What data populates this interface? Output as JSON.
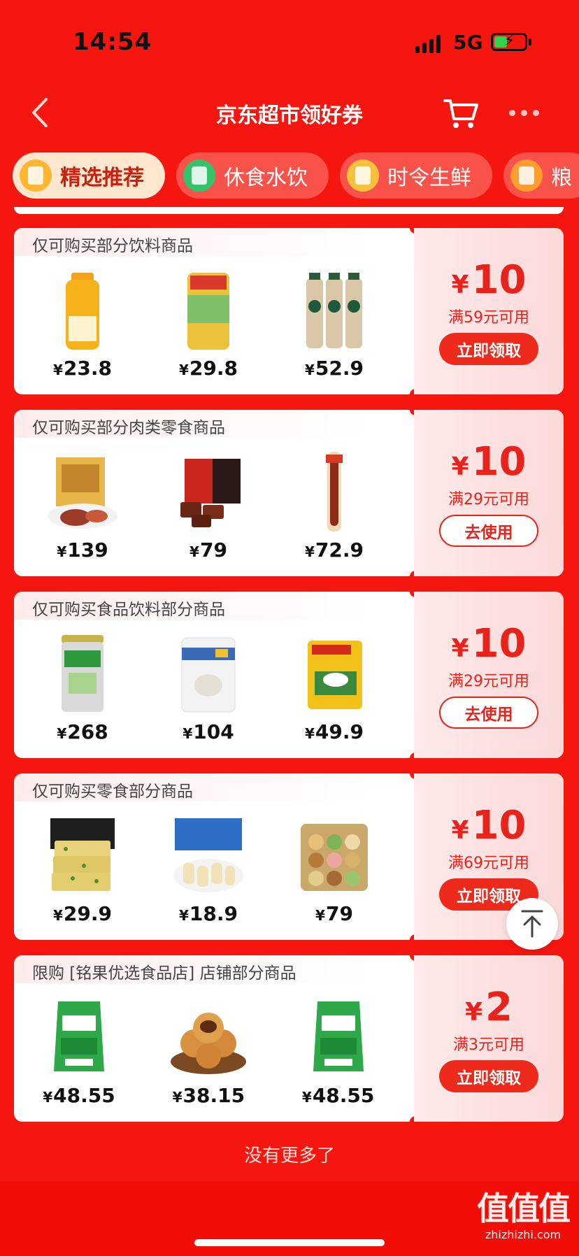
{
  "status_bar": {
    "time": "14:54",
    "network": "5G"
  },
  "nav": {
    "title": "京东超市领好券"
  },
  "tabs": [
    {
      "label": "精选推荐",
      "icon": "coupon-icon",
      "active": true
    },
    {
      "label": "休食水饮",
      "icon": "snack-drink-icon",
      "active": false
    },
    {
      "label": "时令生鲜",
      "icon": "durian-icon",
      "active": false
    },
    {
      "label": "粮",
      "icon": "grain-icon",
      "active": false
    }
  ],
  "coupons": [
    {
      "condition": "仅可购买部分饮料商品",
      "amount": "10",
      "threshold": "满59元可用",
      "cta": "立即领取",
      "cta_style": "primary",
      "products": [
        {
          "name": "orange-juice-bottle",
          "price": "23.8"
        },
        {
          "name": "lemon-tea-can",
          "price": "29.8"
        },
        {
          "name": "starbucks-coffee-bottles",
          "price": "52.9"
        }
      ]
    },
    {
      "condition": "仅可购买部分肉类零食商品",
      "amount": "10",
      "threshold": "满29元可用",
      "cta": "去使用",
      "cta_style": "outline",
      "products": [
        {
          "name": "braised-meat-gift-box",
          "price": "139"
        },
        {
          "name": "beef-jerky-box",
          "price": "79"
        },
        {
          "name": "sausage-stick",
          "price": "72.9"
        }
      ]
    },
    {
      "condition": "仅可购买食品饮料部分商品",
      "amount": "10",
      "threshold": "满29元可用",
      "cta": "去使用",
      "cta_style": "outline",
      "products": [
        {
          "name": "milk-powder-can-green",
          "price": "268"
        },
        {
          "name": "goat-milk-powder-can",
          "price": "104"
        },
        {
          "name": "milk-powder-bag",
          "price": "49.9"
        }
      ]
    },
    {
      "condition": "仅可购买零食部分商品",
      "amount": "10",
      "threshold": "满69元可用",
      "cta": "立即领取",
      "cta_style": "primary",
      "products": [
        {
          "name": "vegetable-crackers-box",
          "price": "29.9"
        },
        {
          "name": "prawn-crackers-bags",
          "price": "18.9"
        },
        {
          "name": "cookies-tin",
          "price": "79"
        }
      ]
    },
    {
      "condition": "限购 [铭果优选食品店] 店铺部分商品",
      "amount": "2",
      "threshold": "满3元可用",
      "cta": "立即领取",
      "cta_style": "primary",
      "products": [
        {
          "name": "yogurt-pouch",
          "price": "48.55"
        },
        {
          "name": "walnut-pastry",
          "price": "38.15"
        },
        {
          "name": "yogurt-pouch",
          "price": "48.55"
        }
      ]
    }
  ],
  "footer": {
    "no_more": "没有更多了"
  },
  "watermark": {
    "big": "值值值",
    "small": "zhizhizhi.com"
  },
  "colors": {
    "background": "#f5170f",
    "accent": "#e8231b",
    "tab_active_bg": "#ffe7cf"
  }
}
